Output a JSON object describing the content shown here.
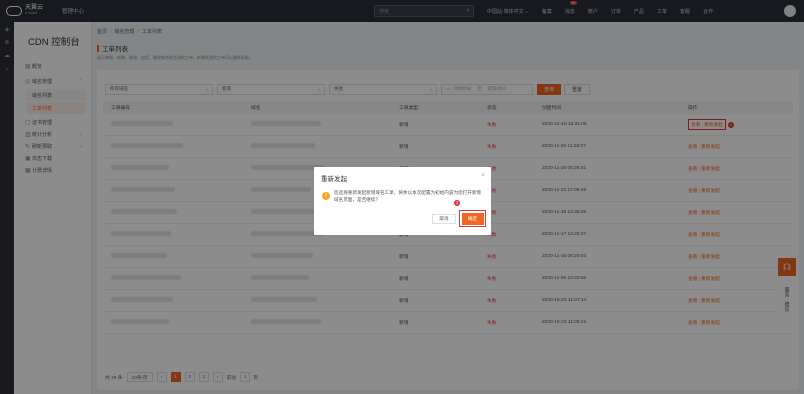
{
  "topbar": {
    "logo_cn": "天翼云",
    "logo_en": "e Cloud",
    "mgmt": "管理中心",
    "search_placeholder": "搜索",
    "nav": [
      {
        "label": "中国站·简体中文 ⌵"
      },
      {
        "label": "备案"
      },
      {
        "label": "消息",
        "badge": "99"
      },
      {
        "label": "帐户"
      },
      {
        "label": "订单"
      },
      {
        "label": "产品"
      },
      {
        "label": "工单"
      },
      {
        "label": "客服"
      },
      {
        "label": "合作"
      }
    ]
  },
  "sidebar": {
    "title": "CDN 控制台",
    "items": [
      {
        "label": "概览"
      },
      {
        "label": "域名管理"
      },
      {
        "label": "域名列表"
      },
      {
        "label": "工单列表"
      },
      {
        "label": "证书管理"
      },
      {
        "label": "统计分析"
      },
      {
        "label": "刷新预取"
      },
      {
        "label": "日志下载"
      },
      {
        "label": "计费详情"
      }
    ]
  },
  "breadcrumb": [
    "首页",
    "域名管理",
    "工单列表"
  ],
  "page": {
    "title": "工单列表",
    "desc": "展示审核、新增、修改、启用、删除域名的生成的工单，新增失败的工单可以重新发起。"
  },
  "filters": {
    "domain": "所有域名",
    "type": "新增",
    "status": "失败",
    "date_start": "开始时间",
    "date_end": "结束时间",
    "query": "查询",
    "reset": "重置"
  },
  "table": {
    "headers": [
      "工单编号",
      "域名",
      "工单类型",
      "状态",
      "创建时间",
      "操作"
    ],
    "rows": [
      {
        "type": "新增",
        "status": "失败",
        "time": "2020-12-10 15:31:00"
      },
      {
        "type": "新增",
        "status": "失败",
        "time": "2020-11-26 11:28:07"
      },
      {
        "type": "新增",
        "status": "失败",
        "time": "2020-11-26 00:36:51"
      },
      {
        "type": "新增",
        "status": "失败",
        "time": "2020-11-23 17:06:49"
      },
      {
        "type": "新增",
        "status": "失败",
        "time": "2020-11-18 14:38:26"
      },
      {
        "type": "新增",
        "status": "失败",
        "time": "2020-11-17 14:28:37"
      },
      {
        "type": "新增",
        "status": "失败",
        "time": "2020-11-16 08:29:03"
      },
      {
        "type": "新增",
        "status": "失败",
        "time": "2020-11-06 10:20:56"
      },
      {
        "type": "新增",
        "status": "失败",
        "time": "2020-10-23 11:07:14"
      },
      {
        "type": "新增",
        "status": "失败",
        "time": "2020-10-23 11:05:21"
      }
    ],
    "op_view": "查看",
    "op_retry": "重新发起"
  },
  "pager": {
    "total": "共 29 条",
    "size": "10条/页",
    "pages": [
      "1",
      "2",
      "3"
    ],
    "goto": "前往",
    "goto_val": "1",
    "page_unit": "页"
  },
  "modal": {
    "title": "重新发起",
    "message": "您选择重新发起新增域名工单，将余以本次配置为初始内容为您打开新增域名页面，是否继续？",
    "cancel": "取消",
    "ok": "确定",
    "step1": "1",
    "step2": "2"
  },
  "float": {
    "feedback": "服务 · 建议"
  },
  "colors": {
    "accent": "#ee6723",
    "danger": "#e4393c",
    "topbar": "#2b2f3a"
  }
}
